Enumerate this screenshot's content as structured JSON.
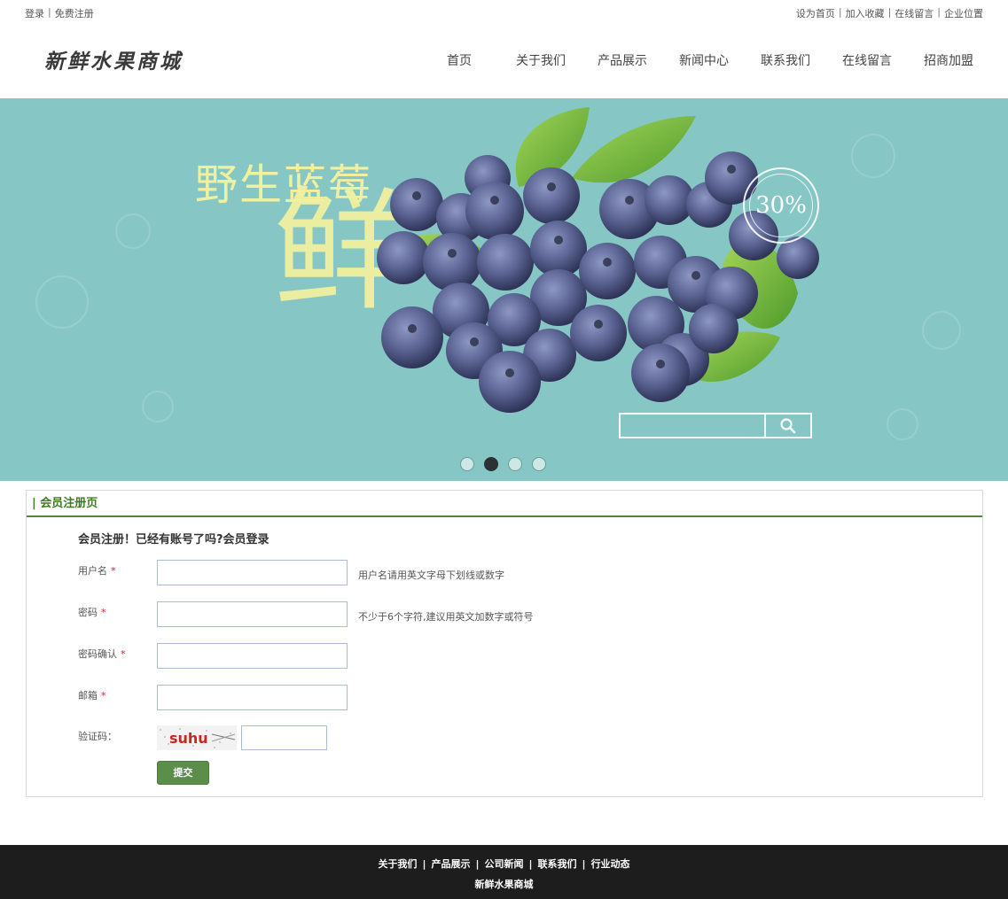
{
  "topbar": {
    "left_links": [
      "登录",
      "免费注册"
    ],
    "right_links": [
      "设为首页",
      "加入收藏",
      "在线留言",
      "企业位置"
    ]
  },
  "header": {
    "logo": "新鲜水果商城",
    "nav": [
      "首页",
      "关于我们",
      "产品展示",
      "新闻中心",
      "联系我们",
      "在线留言",
      "招商加盟"
    ]
  },
  "banner": {
    "title": "野生蓝莓",
    "big_char": "鲜",
    "badge": "30%",
    "slides_count": 4,
    "active_slide": 2,
    "search_icon": "search-icon",
    "background_color": "#86c7c5"
  },
  "register": {
    "panel_title": "| 会员注册页",
    "intro": "会员注册！已经有账号了吗?会员登录",
    "fields": [
      {
        "label": "用户名",
        "required": "*",
        "hint": "用户名请用英文字母下划线或数字",
        "value": ""
      },
      {
        "label": "密码",
        "required": "*",
        "hint": "不少于6个字符,建议用英文加数字或符号",
        "value": ""
      },
      {
        "label": "密码确认",
        "required": "*",
        "hint": "",
        "value": ""
      },
      {
        "label": "邮箱",
        "required": "*",
        "hint": "",
        "value": ""
      }
    ],
    "captcha_label": "验证码：",
    "captcha_text": "suhu",
    "captcha_value": "",
    "submit_label": "提交"
  },
  "footer": {
    "links": [
      "关于我们",
      "产品展示",
      "公司新闻",
      "联系我们",
      "行业动态"
    ],
    "site_name": "新鲜水果商城"
  },
  "colors": {
    "accent_green": "#4f8a3a",
    "submit_green": "#5a8e4a",
    "footer_bg": "#1d1d1d",
    "required_red": "#e02020"
  }
}
